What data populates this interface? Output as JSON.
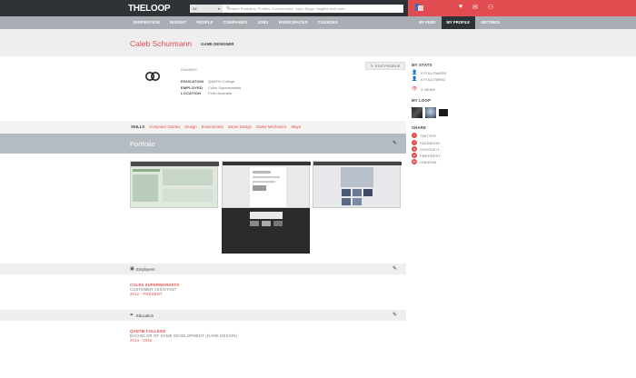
{
  "topbar": {
    "logo_a": "THE",
    "logo_b": "L",
    "logo_c": "OOP",
    "search_scope": "All",
    "search_placeholder": "Search Portfolios, Profiles, Communities, Jobs, Blogs, Insights and more...",
    "icons": [
      "user-icon",
      "heart-icon",
      "mail-icon",
      "users-icon"
    ]
  },
  "nav": {
    "items": [
      "INSPIRATION",
      "INSIGHT",
      "PEOPLE",
      "COMPANIES",
      "JOBS",
      "WORKSPACES",
      "COURSES"
    ],
    "right": [
      "MY FEED",
      "MY PROFILE",
      "SETTINGS"
    ]
  },
  "profile": {
    "name": "Caleb Schurmann",
    "role": "GAME DESIGNER",
    "interest": "GAMING",
    "education_label": "EDUCATION",
    "education_value": "QANTM College",
    "employed_label": "EMPLOYED",
    "employed_value": "Coles Supermarkets",
    "location_label": "LOCATION",
    "location_value": "Perth Australia",
    "edit_label": "EDIT PROFILE"
  },
  "sidebar": {
    "stats_title": "MY STATS",
    "followers": "0 FOLLOWERS",
    "following": "0 FOLLOWING",
    "views": "3 VIEWS",
    "loop_title": "MY LOOP",
    "share_title": "SHARE",
    "share": [
      "TWITTER",
      "FACEBOOK",
      "GOOGLE+1",
      "PINTEREST",
      "LINKEDIN"
    ]
  },
  "skills": {
    "label": "SKILLS",
    "items": [
      "Computer Games",
      "Design",
      "Environment",
      "Game Design",
      "Game Mechanics",
      "Maya"
    ]
  },
  "portfolio": {
    "title": "Portfolio"
  },
  "employers": {
    "title": "Employers",
    "company": "COLES SUPERMARKETS",
    "position": "CUSTOMER ASSISTANT",
    "dates": "2012 - PRESENT"
  },
  "education": {
    "title": "Education",
    "school": "QANTM COLLEGE",
    "course": "BACHELOR OF GAME DEVELOPMENT (GAME DESIGN)",
    "dates": "2014 - 2015"
  },
  "colors": {
    "accent": "#e04c4f",
    "dark": "#2f3337",
    "nav": "#a8aeb4"
  }
}
